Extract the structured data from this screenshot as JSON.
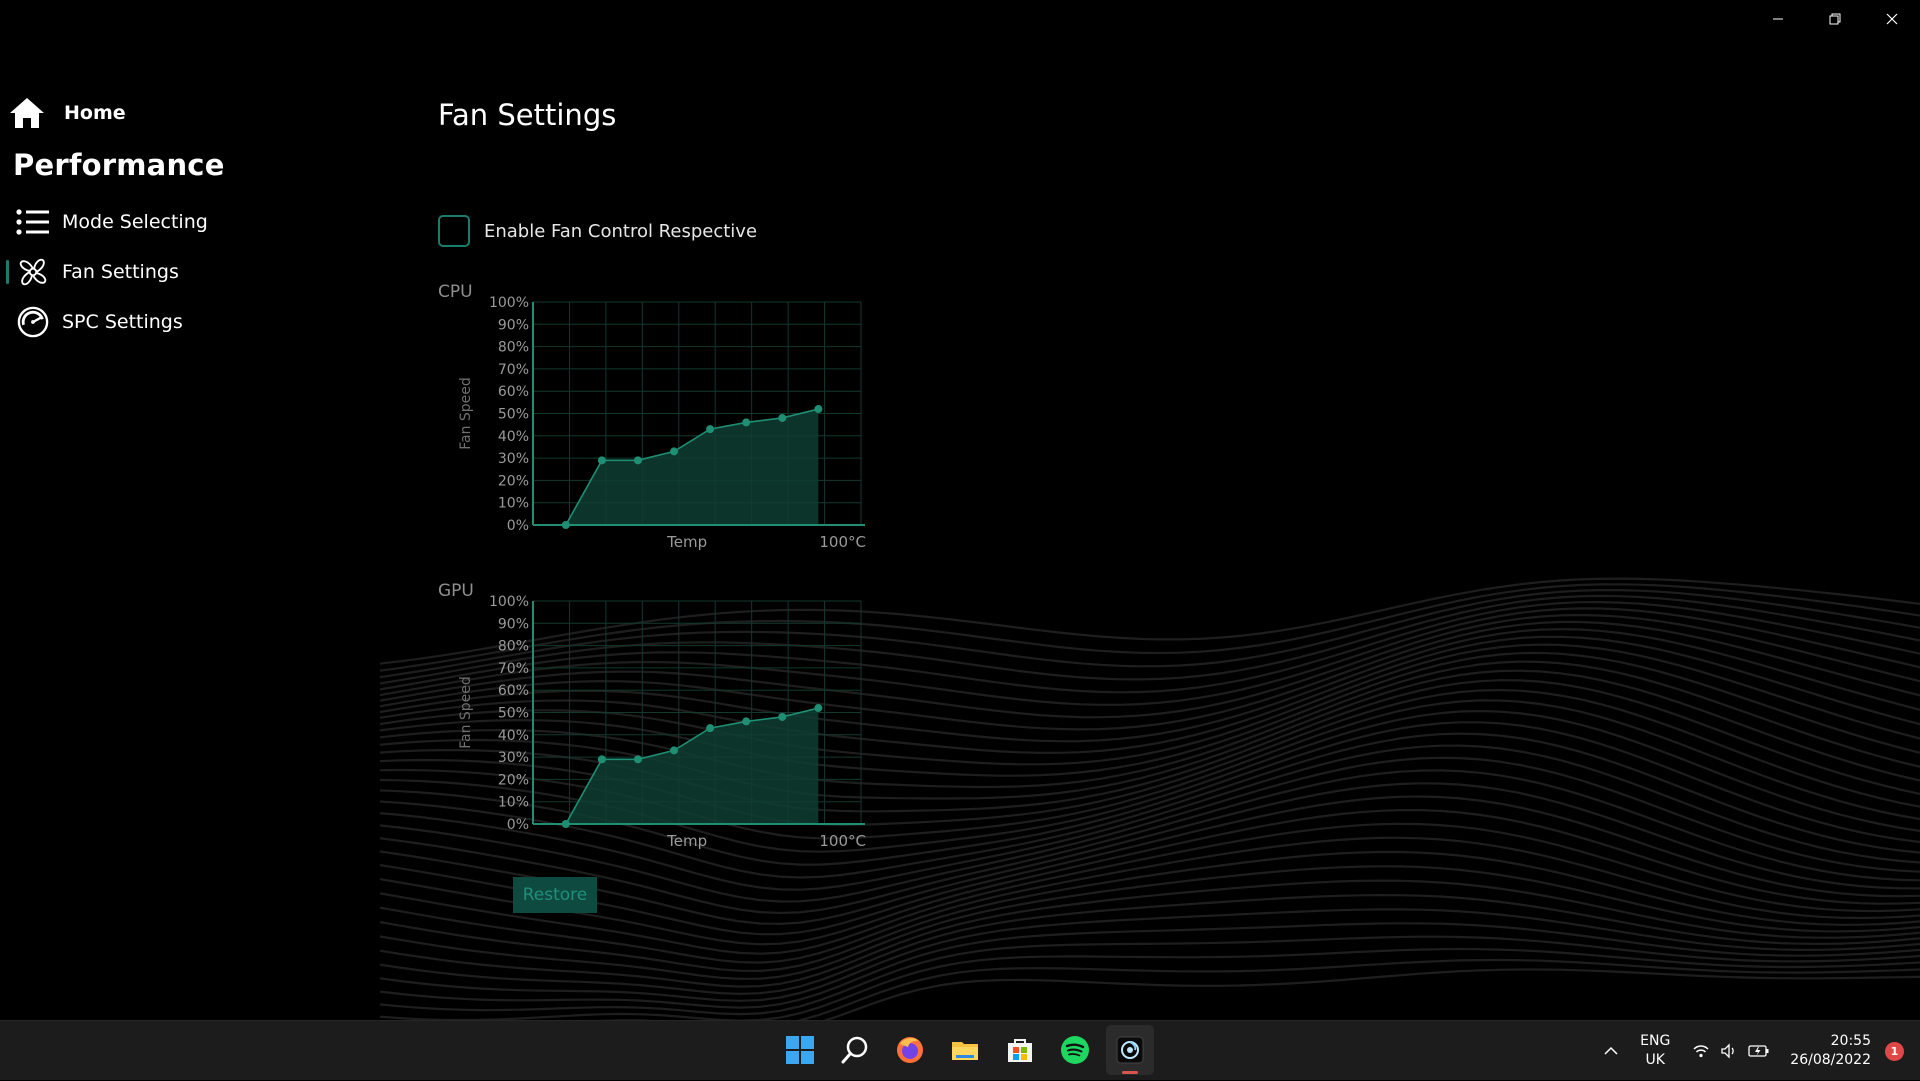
{
  "window": {
    "controls": [
      "minimize",
      "restore",
      "close"
    ]
  },
  "sidebar": {
    "home_label": "Home",
    "section_title": "Performance",
    "items": [
      {
        "label": "Mode Selecting",
        "icon": "list-icon"
      },
      {
        "label": "Fan Settings",
        "icon": "fan-icon",
        "active": true
      },
      {
        "label": "SPC Settings",
        "icon": "gauge-icon"
      }
    ]
  },
  "main": {
    "title": "Fan Settings",
    "enable_checkbox": {
      "label": "Enable Fan Control Respective",
      "checked": false
    },
    "restore_label": "Restore"
  },
  "colors": {
    "accent": "#1a7c6a",
    "chart_line": "#1f8f74",
    "chart_fill": "#0f3d33",
    "grid": "#12382f",
    "restore_bg": "#0f4a40"
  },
  "chart_data": [
    {
      "type": "area",
      "title": "CPU",
      "xlabel": "Temp",
      "x_end_label": "100°C",
      "ylabel": "Fan Speed",
      "ylim": [
        0,
        100
      ],
      "xlim": [
        0,
        100
      ],
      "yticks": [
        "0%",
        "10%",
        "20%",
        "30%",
        "40%",
        "50%",
        "60%",
        "70%",
        "80%",
        "90%",
        "100%"
      ],
      "grid": true,
      "x": [
        10,
        21,
        32,
        43,
        54,
        65,
        76,
        87
      ],
      "values": [
        0,
        29,
        29,
        33,
        43,
        46,
        48,
        52
      ]
    },
    {
      "type": "area",
      "title": "GPU",
      "xlabel": "Temp",
      "x_end_label": "100°C",
      "ylabel": "Fan Speed",
      "ylim": [
        0,
        100
      ],
      "xlim": [
        0,
        100
      ],
      "yticks": [
        "0%",
        "10%",
        "20%",
        "30%",
        "40%",
        "50%",
        "60%",
        "70%",
        "80%",
        "90%",
        "100%"
      ],
      "grid": true,
      "x": [
        10,
        21,
        32,
        43,
        54,
        65,
        76,
        87
      ],
      "values": [
        0,
        29,
        29,
        33,
        43,
        46,
        48,
        52
      ]
    }
  ],
  "taskbar": {
    "apps": [
      {
        "name": "start-icon"
      },
      {
        "name": "search-icon"
      },
      {
        "name": "firefox-icon"
      },
      {
        "name": "file-explorer-icon"
      },
      {
        "name": "store-icon"
      },
      {
        "name": "spotify-icon"
      },
      {
        "name": "fan-app-icon",
        "active": true
      }
    ],
    "lang_top": "ENG",
    "lang_bottom": "UK",
    "time": "20:55",
    "date": "26/08/2022",
    "notification_count": "1"
  }
}
